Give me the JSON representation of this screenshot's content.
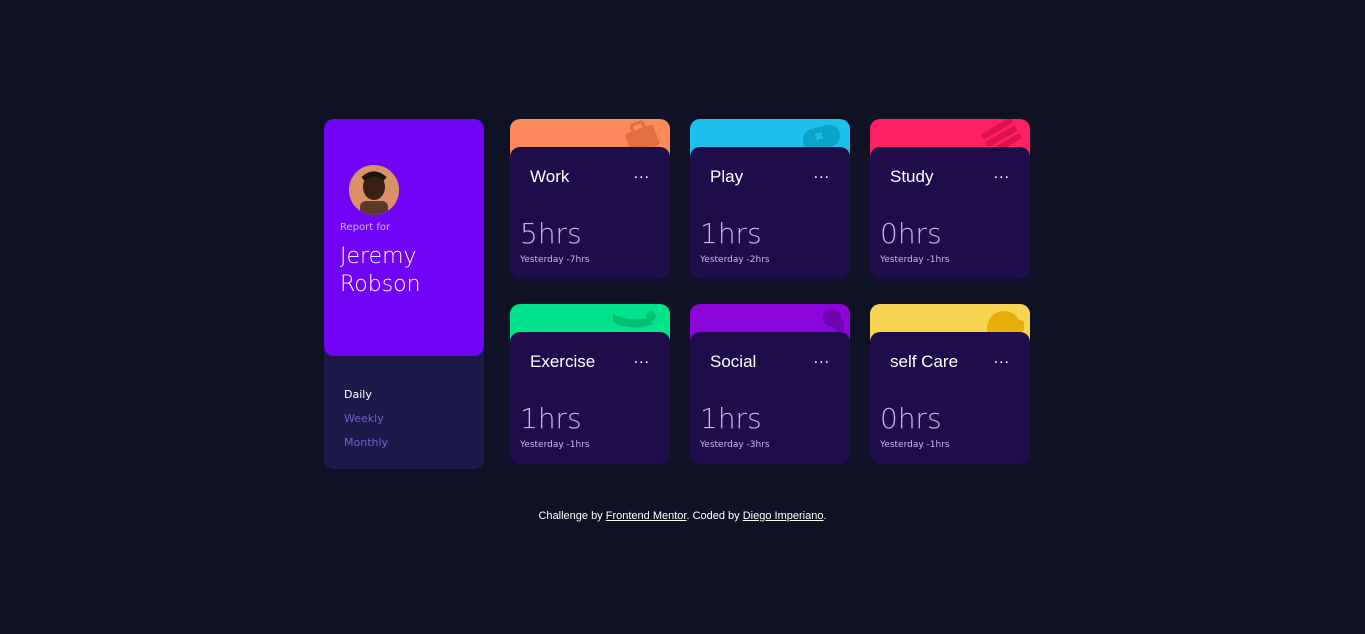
{
  "profile": {
    "report_for": "Report for",
    "name": "Jeremy Robson"
  },
  "periods": [
    {
      "label": "Daily",
      "active": true
    },
    {
      "label": "Weekly",
      "active": false
    },
    {
      "label": "Monthly",
      "active": false
    }
  ],
  "cards": [
    {
      "title": "Work",
      "more": "...",
      "current": "5hrs",
      "previous": "Yesterday -7hrs",
      "color": "#ff8b5c",
      "icon": "briefcase-icon"
    },
    {
      "title": "Play",
      "more": "...",
      "current": "1hrs",
      "previous": "Yesterday -2hrs",
      "color": "#1ec0eb",
      "icon": "gamepad-icon"
    },
    {
      "title": "Study",
      "more": "...",
      "current": "0hrs",
      "previous": "Yesterday -1hrs",
      "color": "#ff2064",
      "icon": "book-icon"
    },
    {
      "title": "Exercise",
      "more": "...",
      "current": "1hrs",
      "previous": "Yesterday -1hrs",
      "color": "#00e38b",
      "icon": "running-icon"
    },
    {
      "title": "Social",
      "more": "...",
      "current": "1hrs",
      "previous": "Yesterday -3hrs",
      "color": "#8a06d9",
      "icon": "chat-icon"
    },
    {
      "title": "self Care",
      "more": "...",
      "current": "0hrs",
      "previous": "Yesterday -1hrs",
      "color": "#f6d350",
      "icon": "heart-icon"
    }
  ],
  "footer": {
    "prefix": "Challenge by ",
    "link1": "Frontend Mentor",
    "middle": ". Coded by ",
    "link2": "Diego Imperiano",
    "suffix": "."
  }
}
